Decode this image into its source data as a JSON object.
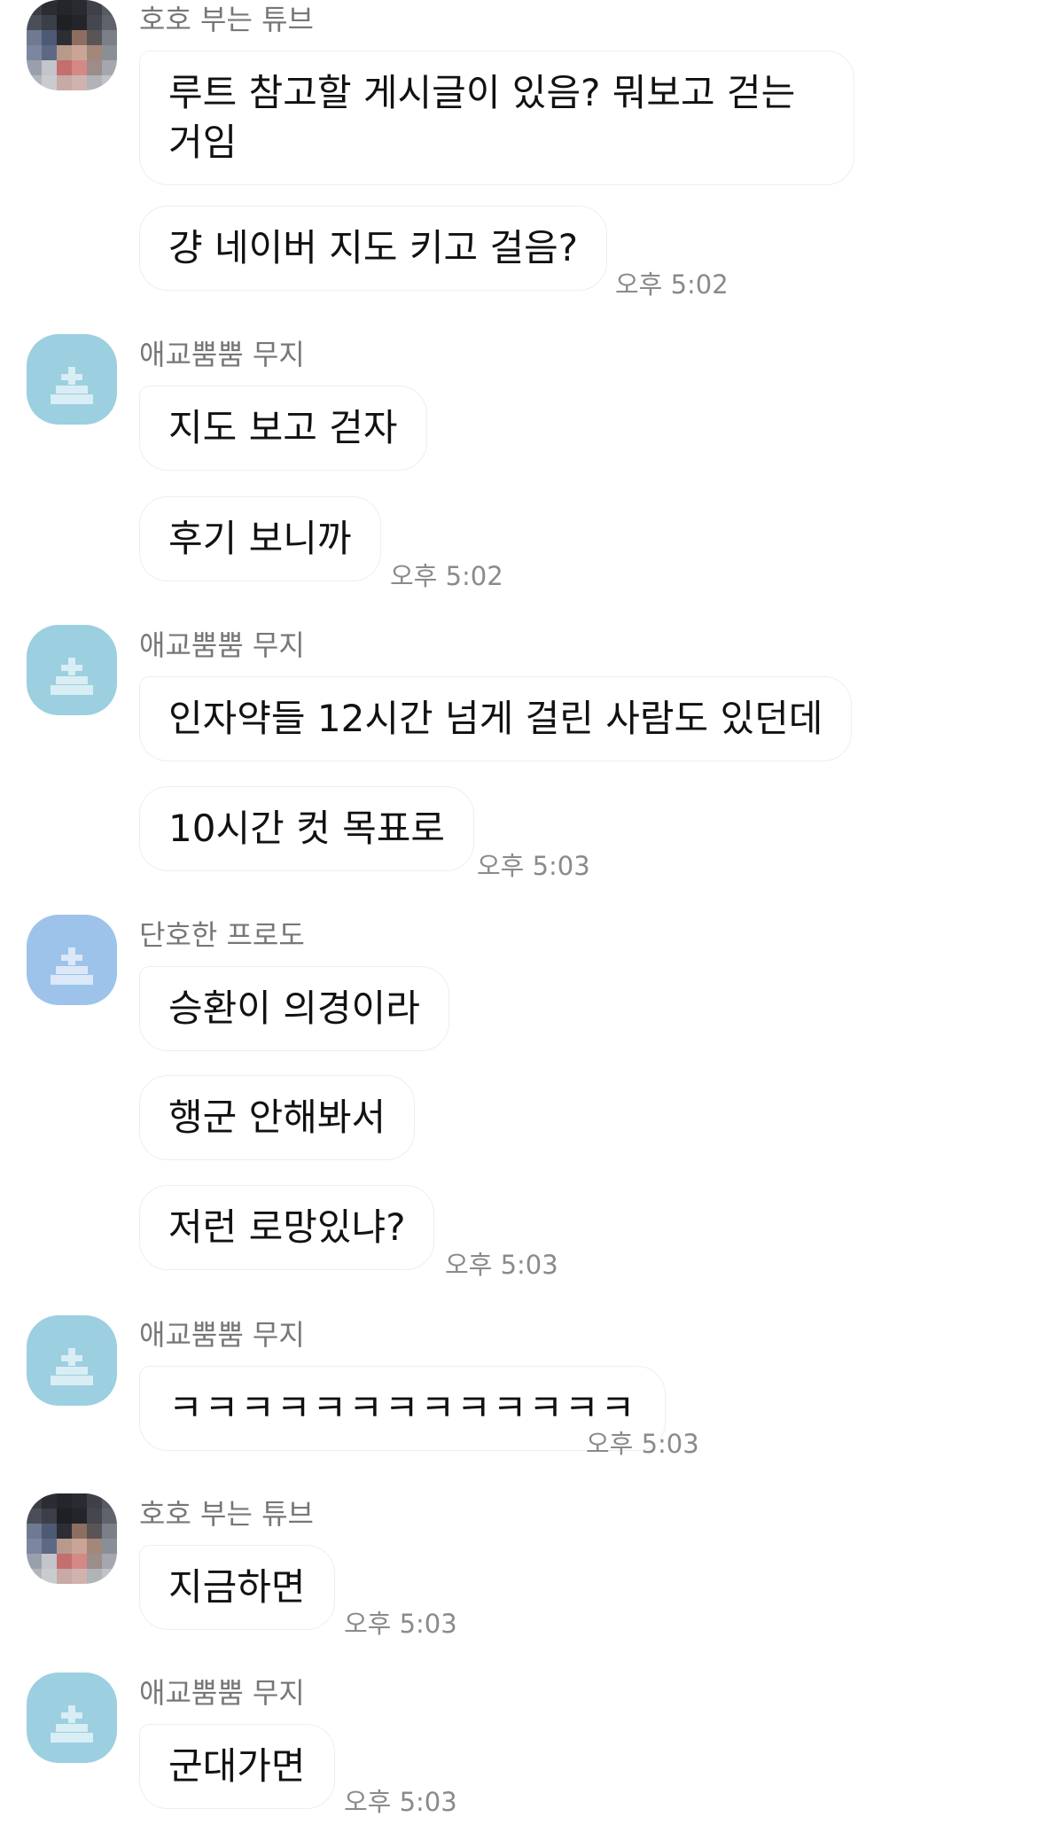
{
  "colors": {
    "background": "#ffffff",
    "bubble_border": "#eeeeee",
    "sender_text": "#777777",
    "timestamp_text": "#8a8a8a",
    "default_avatar_teal": "#9ccfe0",
    "default_avatar_blue": "#9dc3ea"
  },
  "groups": [
    {
      "sender": "호호 부는 튜브",
      "avatar_icon": "photo-avatar-icon",
      "messages": [
        "루트 참고할 게시글이 있음? 뭐보고 걷는거임",
        "걍 네이버 지도 키고 걸음?"
      ],
      "time": "오후 5:02"
    },
    {
      "sender": "애교뿜뿜 무지",
      "avatar_icon": "default-profile-icon",
      "messages": [
        "지도 보고 걷자",
        "후기 보니까"
      ],
      "time": "오후 5:02"
    },
    {
      "sender": "애교뿜뿜 무지",
      "avatar_icon": "default-profile-icon",
      "messages": [
        "인자약들 12시간 넘게 걸린 사람도 있던데",
        "10시간 컷 목표로"
      ],
      "time": "오후 5:03"
    },
    {
      "sender": "단호한 프로도",
      "avatar_icon": "default-profile-icon",
      "messages": [
        "승환이 의경이라",
        "행군 안해봐서",
        "저런 로망있냐?"
      ],
      "time": "오후 5:03"
    },
    {
      "sender": "애교뿜뿜 무지",
      "avatar_icon": "default-profile-icon",
      "messages": [
        "ㅋㅋㅋㅋㅋㅋㅋㅋㅋㅋㅋㅋㅋ"
      ],
      "time": "오후 5:03"
    },
    {
      "sender": "호호 부는 튜브",
      "avatar_icon": "photo-avatar-icon",
      "messages": [
        "지금하면"
      ],
      "time": "오후 5:03"
    },
    {
      "sender": "애교뿜뿜 무지",
      "avatar_icon": "default-profile-icon",
      "messages": [
        "군대가면"
      ],
      "time": "오후 5:03"
    }
  ]
}
